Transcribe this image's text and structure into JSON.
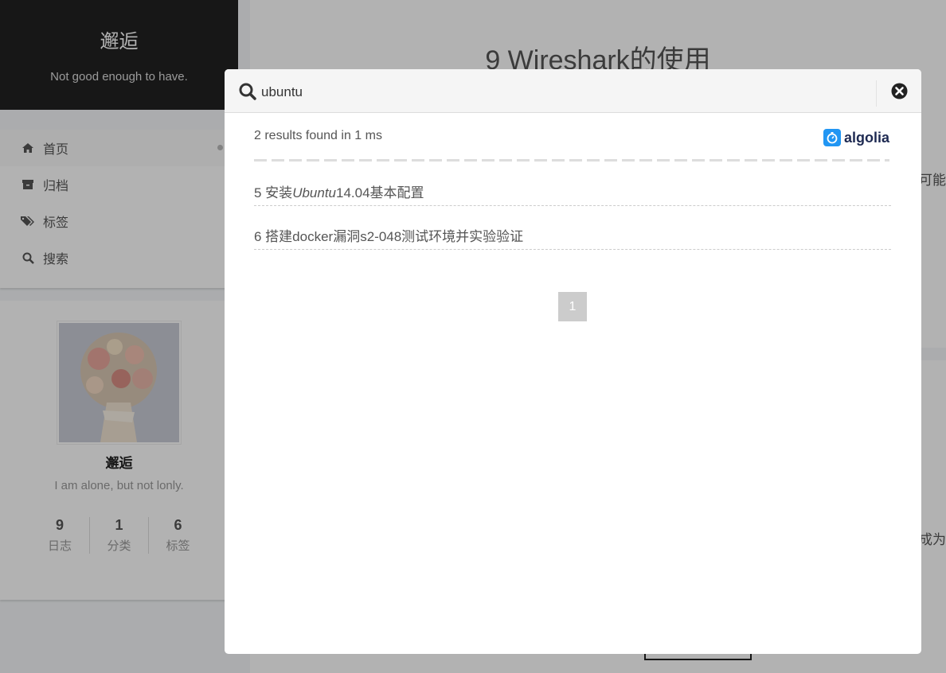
{
  "site": {
    "title": "邂逅",
    "subtitle": "Not good enough to have."
  },
  "menu": {
    "items": [
      {
        "label": "首页",
        "icon": "home-icon",
        "active": true
      },
      {
        "label": "归档",
        "icon": "archive-icon"
      },
      {
        "label": "标签",
        "icon": "tags-icon"
      },
      {
        "label": "搜索",
        "icon": "search-icon"
      }
    ]
  },
  "profile": {
    "name": "邂逅",
    "description": "I am alone, but not lonly.",
    "avatar_icon": "flower-bouquet-photo",
    "stats": [
      {
        "count": "9",
        "label": "日志"
      },
      {
        "count": "1",
        "label": "分类"
      },
      {
        "count": "6",
        "label": "标签"
      }
    ]
  },
  "main": {
    "post_title": "9 Wireshark的使用",
    "peek_text_1": "可能",
    "peek_text_2": "成为"
  },
  "search": {
    "query": "ubuntu",
    "results_stats": "2 results found in 1 ms",
    "provider": "algolia",
    "results": [
      {
        "prefix": "5 安装",
        "highlight": "Ubuntu",
        "suffix": "14.04基本配置"
      },
      {
        "prefix": "6 搭建docker漏洞s2-048测试环境并实验验证",
        "highlight": "",
        "suffix": ""
      }
    ],
    "current_page": "1"
  },
  "colors": {
    "sidebar_bg": "#222222",
    "overlay": "rgba(0,0,0,0.3)",
    "algolia_blue": "#2196f3",
    "page_button": "#cccccc"
  }
}
